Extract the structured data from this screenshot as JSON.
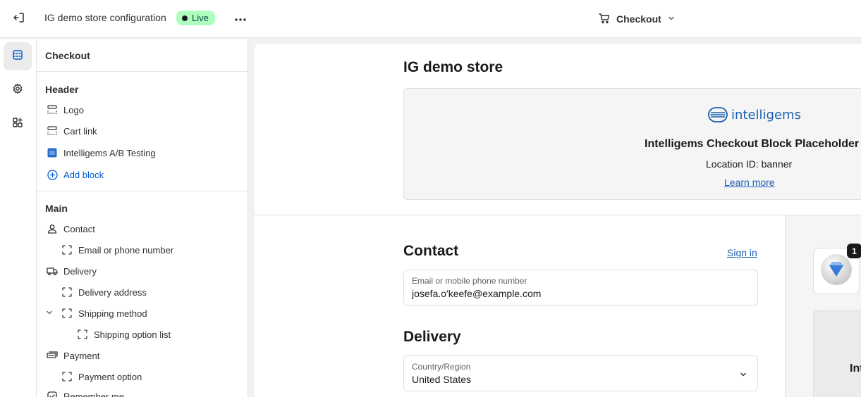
{
  "topbar": {
    "exit_icon": "exit-icon",
    "title": "IG demo store configuration",
    "status_badge": "Live",
    "more_icon": "more-horizontal-icon",
    "page_selector": {
      "icon": "cart-icon",
      "label": "Checkout",
      "chevron_icon": "chevron-down-icon"
    }
  },
  "rail": {
    "items": [
      {
        "icon": "sections-icon",
        "active": true
      },
      {
        "icon": "gear-icon",
        "active": false
      },
      {
        "icon": "apps-icon",
        "active": false
      }
    ]
  },
  "sidebar": {
    "title": "Checkout",
    "header_section": {
      "heading": "Header",
      "items": [
        {
          "label": "Logo",
          "icon": "layout-block-icon"
        },
        {
          "label": "Cart link",
          "icon": "layout-block-icon"
        },
        {
          "label": "Intelligems A/B Testing",
          "icon": "intelligems-app-icon"
        }
      ],
      "add_block": "Add block"
    },
    "main_section": {
      "heading": "Main",
      "items": [
        {
          "label": "Contact",
          "icon": "person-icon",
          "level": 0
        },
        {
          "label": "Email or phone number",
          "icon": "dashed-block-icon",
          "level": 1
        },
        {
          "label": "Delivery",
          "icon": "truck-icon",
          "level": 0
        },
        {
          "label": "Delivery address",
          "icon": "dashed-block-icon",
          "level": 1
        },
        {
          "label": "Shipping method",
          "icon": "dashed-block-icon",
          "level": 1,
          "expanded": true
        },
        {
          "label": "Shipping option list",
          "icon": "dashed-block-icon",
          "level": 2
        },
        {
          "label": "Payment",
          "icon": "cash-icon",
          "level": 0
        },
        {
          "label": "Payment option",
          "icon": "dashed-block-icon",
          "level": 1
        },
        {
          "label": "Remember me",
          "icon": "checkbox-icon",
          "level": 0
        }
      ]
    }
  },
  "preview": {
    "store_name": "IG demo store",
    "placeholder": {
      "logo_text": "intelligems",
      "title": "Intelligems Checkout Block Placeholder",
      "location": "Location ID: banner",
      "link": "Learn more"
    },
    "contact": {
      "heading": "Contact",
      "sign_in": "Sign in",
      "field_label": "Email or mobile phone number",
      "field_value": "josefa.o'keefe@example.com"
    },
    "delivery": {
      "heading": "Delivery",
      "country_label": "Country/Region",
      "country_value": "United States"
    },
    "order_summary": {
      "quantity": "1",
      "product_icon": "golf-ball-icon",
      "block_text": "Int"
    }
  }
}
